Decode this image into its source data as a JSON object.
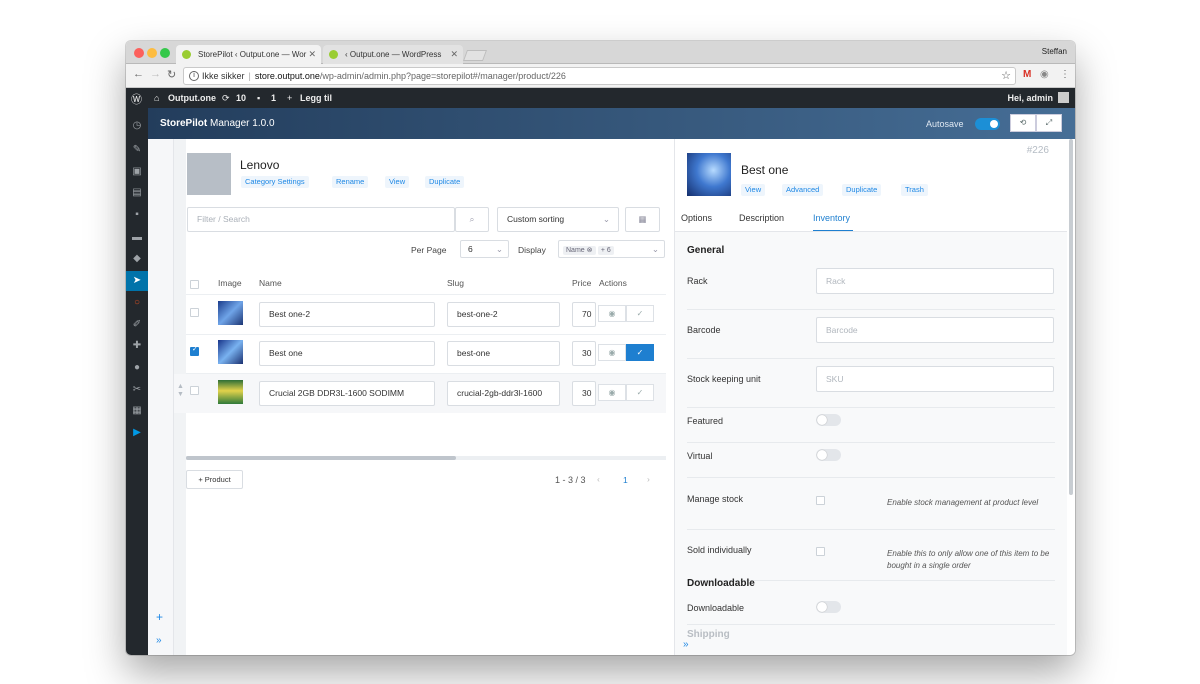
{
  "browser": {
    "tabs": [
      {
        "title": "StorePilot ‹ Output.one — Wor",
        "active": true
      },
      {
        "title": "‹ Output.one — WordPress",
        "active": false
      }
    ],
    "user": "Steffan",
    "security_label": "Ikke sikker",
    "url_host": "store.output.one",
    "url_path": "/wp-admin/admin.php?page=storepilot#/manager/product/226"
  },
  "adminbar": {
    "site": "Output.one",
    "updates": "10",
    "comments": "1",
    "new_label": "Legg til",
    "greeting": "Hei, admin"
  },
  "header": {
    "app_name": "StorePilot",
    "app_suffix": " Manager 1.0.0",
    "autosave_label": "Autosave",
    "autosave_on": true
  },
  "category": {
    "name": "Lenovo",
    "actions": [
      "Category Settings",
      "Rename",
      "View",
      "Duplicate"
    ]
  },
  "filter": {
    "search_placeholder": "Filter / Search",
    "sorting": "Custom sorting",
    "per_page_label": "Per Page",
    "per_page_value": "6",
    "display_label": "Display",
    "display_tag": "Name",
    "display_more": "+ 6"
  },
  "table": {
    "headers": [
      "Image",
      "Name",
      "Slug",
      "Price",
      "Actions"
    ],
    "rows": [
      {
        "name": "Best one-2",
        "slug": "best-one-2",
        "price": "70",
        "checked": false
      },
      {
        "name": "Best one",
        "slug": "best-one",
        "price": "30",
        "checked": true
      },
      {
        "name": "Crucial 2GB DDR3L-1600 SODIMM",
        "slug": "crucial-2gb-ddr3l-1600",
        "price": "30",
        "checked": false
      }
    ]
  },
  "footer": {
    "add_label": "+ Product",
    "range": "1 - 3 / 3",
    "page": "1"
  },
  "product": {
    "id": "#226",
    "title": "Best one",
    "actions": [
      "View",
      "Advanced",
      "Duplicate",
      "Trash"
    ],
    "tabs": [
      "Options",
      "Description",
      "Inventory"
    ],
    "active_tab": "Inventory"
  },
  "inventory": {
    "general_heading": "General",
    "rack_label": "Rack",
    "rack_placeholder": "Rack",
    "barcode_label": "Barcode",
    "barcode_placeholder": "Barcode",
    "sku_label": "Stock keeping unit",
    "sku_placeholder": "SKU",
    "featured_label": "Featured",
    "virtual_label": "Virtual",
    "manage_stock_label": "Manage stock",
    "manage_stock_hint": "Enable stock management at product level",
    "sold_individually_label": "Sold individually",
    "sold_individually_hint": "Enable this to only allow one of this item to be bought in a single order",
    "downloadable_heading": "Downloadable",
    "downloadable_label": "Downloadable",
    "shipping_heading": "Shipping"
  },
  "colors": {
    "accent": "#1e7fd0",
    "header_start": "#233d5c",
    "header_end": "#466e96",
    "wp_dark": "#23282d"
  }
}
